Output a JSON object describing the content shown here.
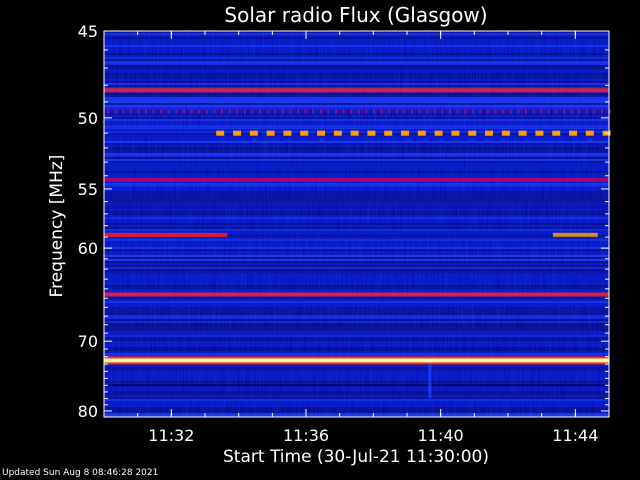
{
  "footer": {
    "updated": "Updated Sun Aug  8 08:46:28 2021"
  },
  "colors": {
    "background": "#000000",
    "axis": "#ffffff",
    "text": "#ffffff"
  },
  "chart_data": {
    "type": "heatmap",
    "title": "Solar radio Flux (Glasgow)",
    "xlabel": "Start Time (30-Jul-21 11:30:00)",
    "ylabel": "Frequency [MHz]",
    "x_units": "minutes",
    "xlim": [
      "11:30:00",
      "11:45:00"
    ],
    "ylim": [
      45,
      81
    ],
    "y_scale": "reciprocal",
    "x_ticks": [
      "11:32",
      "11:36",
      "11:40",
      "11:44"
    ],
    "y_ticks": [
      45,
      50,
      55,
      60,
      70,
      80
    ],
    "colormap": [
      "#000060",
      "#0010c0",
      "#2040ff",
      "#c00060",
      "#ff2020",
      "#ffa000",
      "#ffffa0"
    ],
    "features": [
      {
        "name": "band 48.3 MHz",
        "frequency_mhz": 48.3,
        "intensity": "high",
        "start": "11:30:00",
        "end": "11:45:00"
      },
      {
        "name": "pulsed 49.6 MHz",
        "frequency_mhz": 49.6,
        "intensity": "medium",
        "start": "11:30:00",
        "end": "11:45:00",
        "pattern": "dotted"
      },
      {
        "name": "pulsed 51.0 MHz",
        "frequency_mhz": 51.0,
        "intensity": "very-high",
        "start": "11:33:20",
        "end": "11:45:00",
        "pattern": "dashed"
      },
      {
        "name": "band 54.3 MHz",
        "frequency_mhz": 54.3,
        "intensity": "medium",
        "start": "11:30:00",
        "end": "11:45:00"
      },
      {
        "name": "burst 58.8 MHz",
        "frequency_mhz": 58.8,
        "intensity": "high",
        "start": "11:30:00",
        "end": "11:33:40"
      },
      {
        "name": "burst 58.8 MHz late",
        "frequency_mhz": 58.8,
        "intensity": "very-high",
        "start": "11:43:20",
        "end": "11:44:40"
      },
      {
        "name": "band 64.6 MHz",
        "frequency_mhz": 64.6,
        "intensity": "high",
        "start": "11:30:00",
        "end": "11:45:00"
      },
      {
        "name": "band 72.5 MHz",
        "frequency_mhz": 72.5,
        "intensity": "saturated",
        "start": "11:30:00",
        "end": "11:45:00"
      },
      {
        "name": "band 76.0 MHz",
        "frequency_mhz": 76.0,
        "intensity": "low",
        "start": "11:30:00",
        "end": "11:45:00"
      },
      {
        "name": "spike 11:39:40",
        "time": "11:39:40",
        "freq_range_mhz": [
          73,
          78
        ],
        "intensity": "medium"
      }
    ]
  }
}
